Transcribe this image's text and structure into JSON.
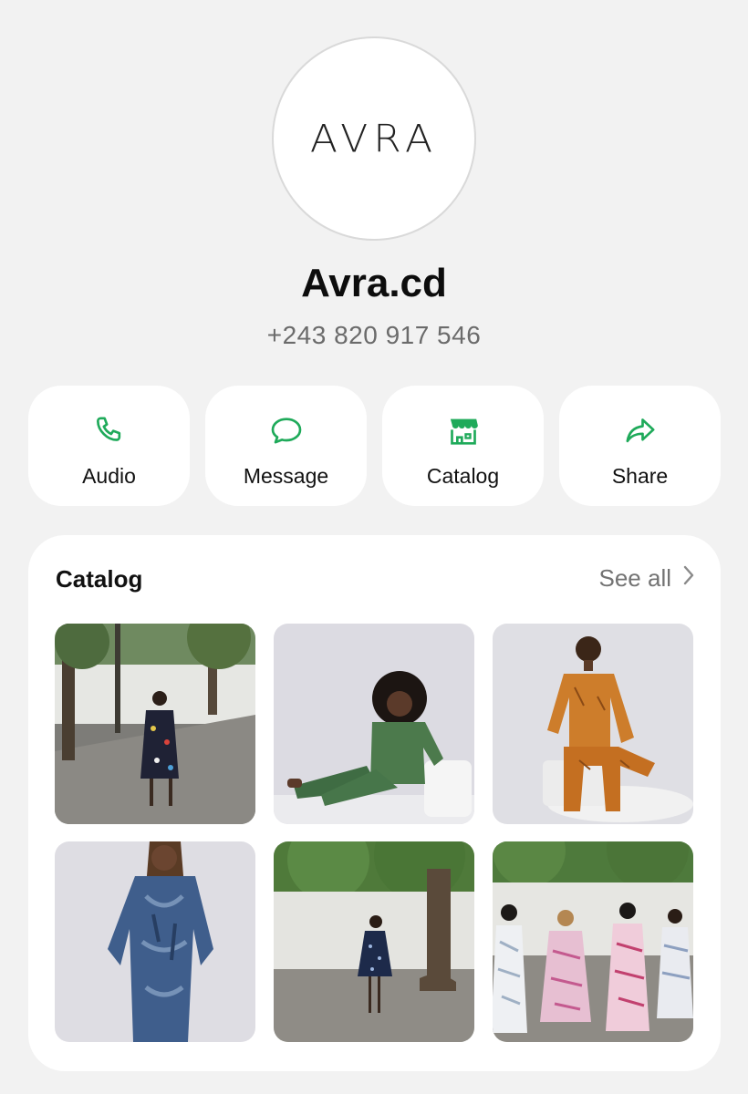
{
  "profile": {
    "logo_text": "AVRA",
    "name": "Avra.cd",
    "phone": "+243 820 917 546"
  },
  "actions": [
    {
      "label": "Audio",
      "icon": "phone-icon"
    },
    {
      "label": "Message",
      "icon": "message-bubble-icon"
    },
    {
      "label": "Catalog",
      "icon": "storefront-icon"
    },
    {
      "label": "Share",
      "icon": "share-arrow-icon"
    }
  ],
  "catalog": {
    "title": "Catalog",
    "see_all": "See all",
    "items": [
      {
        "thumb": "Woman in floral dress walking outdoors"
      },
      {
        "thumb": "Woman in green outfit seated in studio"
      },
      {
        "thumb": "Woman in orange patterned outfit seated"
      },
      {
        "thumb": "Woman in blue tie-dye kaftan"
      },
      {
        "thumb": "Woman in navy dress walking under tree"
      },
      {
        "thumb": "Group of women in printed kaftans walking"
      }
    ]
  },
  "colors": {
    "accent_green": "#1faa5a",
    "background": "#f2f2f2",
    "card": "#ffffff",
    "muted_text": "#6b6b6b"
  }
}
